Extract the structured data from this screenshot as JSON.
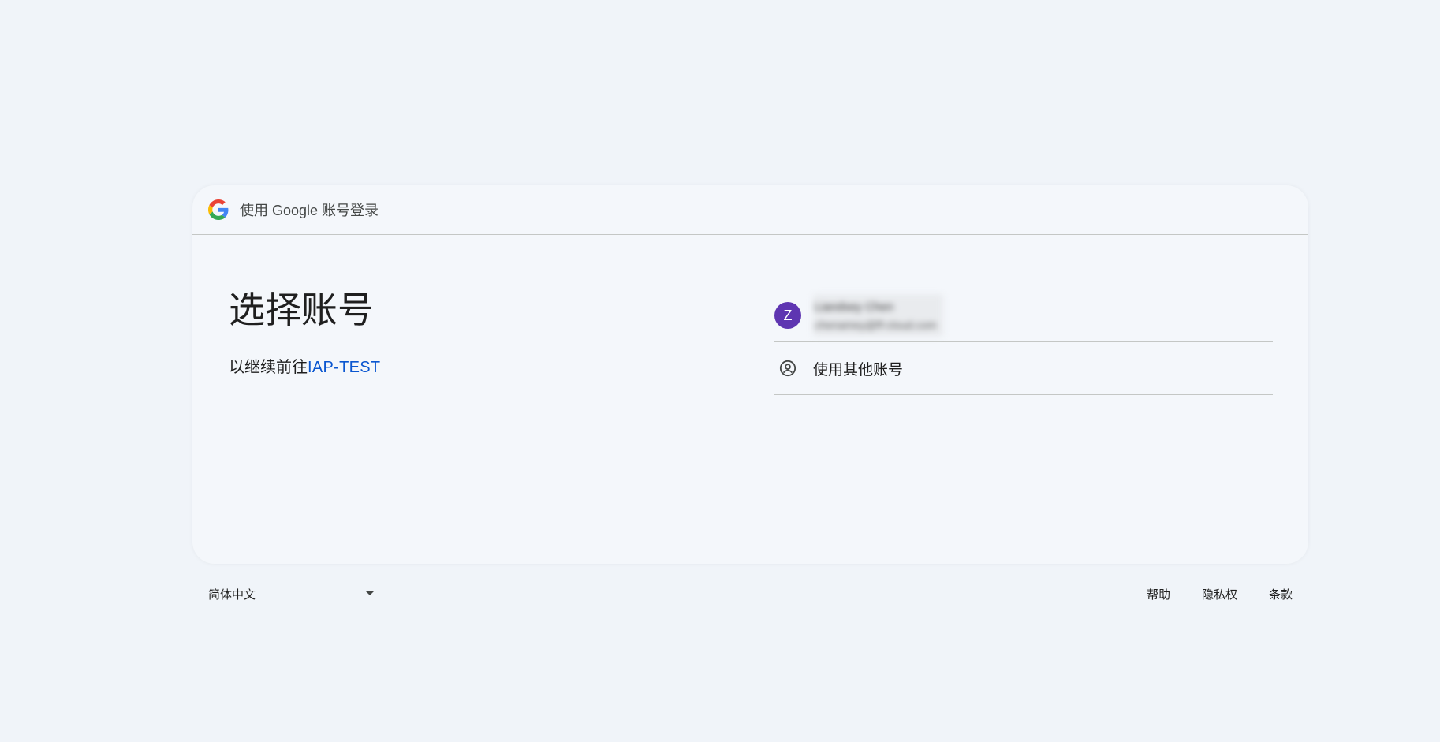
{
  "header": {
    "title": "使用 Google 账号登录"
  },
  "main": {
    "title": "选择账号",
    "subtitle_prefix": "以继续前往",
    "app_name": "IAP-TEST"
  },
  "accounts": [
    {
      "avatar_letter": "Z",
      "avatar_color": "#5e35b1",
      "name": "Liandsey Chen",
      "email": "chenamey@ff-cloud.com"
    }
  ],
  "other_account": {
    "label": "使用其他账号"
  },
  "footer": {
    "language": "简体中文",
    "links": {
      "help": "帮助",
      "privacy": "隐私权",
      "terms": "条款"
    }
  },
  "colors": {
    "background": "#f0f4f9",
    "card": "#f4f7fb",
    "link": "#0b57d0",
    "divider": "#c4c7c5"
  }
}
